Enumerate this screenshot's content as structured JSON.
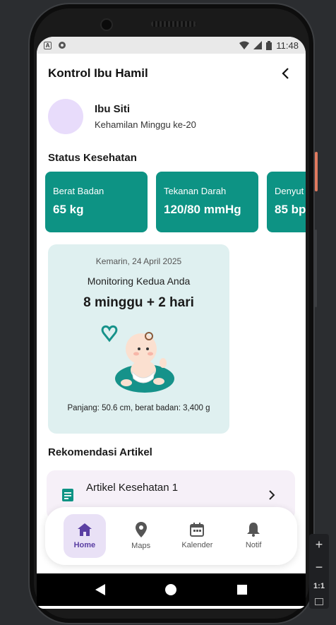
{
  "status_bar": {
    "time": "11:48",
    "notif_icon": "a-icon",
    "media_icon": "circle-icon"
  },
  "app_bar": {
    "title": "Kontrol Ibu Hamil",
    "back_icon": "chevron-left-icon"
  },
  "profile": {
    "name": "Ibu Siti",
    "subtitle": "Kehamilan Minggu ke-20"
  },
  "health_status": {
    "title": "Status Kesehatan",
    "cards": [
      {
        "label": "Berat Badan",
        "value": "65 kg"
      },
      {
        "label": "Tekanan Darah",
        "value": "120/80 mmHg"
      },
      {
        "label": "Denyut",
        "value": "85 bp"
      }
    ]
  },
  "monitoring": {
    "date": "Kemarin, 24 April 2025",
    "title": "Monitoring Kedua Anda",
    "weeks": "8 minggu + 2 hari",
    "footer": "Panjang: 50.6 cm, berat badan: 3,400 g"
  },
  "articles": {
    "title": "Rekomendasi Artikel",
    "items": [
      {
        "title": "Artikel Kesehatan 1"
      }
    ]
  },
  "bottom_nav": [
    {
      "label": "Home",
      "icon": "home-icon",
      "active": true
    },
    {
      "label": "Maps",
      "icon": "location-pin-icon",
      "active": false
    },
    {
      "label": "Kalender",
      "icon": "calendar-icon",
      "active": false
    },
    {
      "label": "Notif",
      "icon": "bell-icon",
      "active": false
    }
  ],
  "zoom": {
    "ratio": "1:1"
  },
  "colors": {
    "accent_teal": "#0d9384",
    "monitor_bg": "#dff0f0",
    "active_nav": "#e9e1f6",
    "active_nav_text": "#5b3fa3"
  }
}
